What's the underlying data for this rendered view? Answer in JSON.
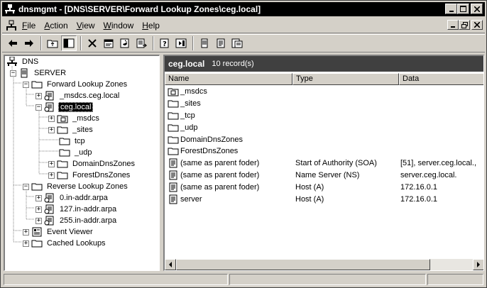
{
  "window": {
    "title": "dnsmgmt - [DNS\\SERVER\\Forward Lookup Zones\\ceg.local]",
    "controls": [
      "minimize",
      "maximize",
      "close"
    ]
  },
  "menu": {
    "items": [
      {
        "label": "File",
        "key": "F",
        "rest": "ile"
      },
      {
        "label": "Action",
        "key": "A",
        "rest": "ction"
      },
      {
        "label": "View",
        "key": "V",
        "rest": "iew"
      },
      {
        "label": "Window",
        "key": "W",
        "rest": "indow"
      },
      {
        "label": "Help",
        "key": "H",
        "rest": "elp"
      }
    ]
  },
  "toolbar": {
    "tools": [
      "back-icon",
      "forward-icon",
      "up-folder-icon",
      "show-hide-tree-icon",
      "delete-icon",
      "properties-icon",
      "refresh-icon",
      "export-list-icon",
      "help-icon",
      "action-pane-icon",
      "server-icon",
      "record-icon",
      "new-zone-icon"
    ]
  },
  "tree": {
    "root": "DNS",
    "server": "SERVER",
    "forward_zones": "Forward Lookup Zones",
    "msdcs_zone": "_msdcs.ceg.local",
    "selected_zone": "ceg.local",
    "children": [
      "_msdcs",
      "_sites",
      "tcp",
      "_udp",
      "DomainDnsZones",
      "ForestDnsZones"
    ],
    "reverse_zones": "Reverse Lookup Zones",
    "reverse_items": [
      "0.in-addr.arpa",
      "127.in-addr.arpa",
      "255.in-addr.arpa"
    ],
    "event_viewer": "Event Viewer",
    "cached_lookups": "Cached Lookups"
  },
  "details": {
    "zone_name": "ceg.local",
    "record_count": "10 record(s)",
    "columns": [
      "Name",
      "Type",
      "Data"
    ],
    "rows": [
      {
        "icon": "delegated-folder-icon",
        "name": "_msdcs",
        "type": "",
        "data": ""
      },
      {
        "icon": "folder-icon",
        "name": "_sites",
        "type": "",
        "data": ""
      },
      {
        "icon": "folder-icon",
        "name": "_tcp",
        "type": "",
        "data": ""
      },
      {
        "icon": "folder-icon",
        "name": "_udp",
        "type": "",
        "data": ""
      },
      {
        "icon": "folder-icon",
        "name": "DomainDnsZones",
        "type": "",
        "data": ""
      },
      {
        "icon": "folder-icon",
        "name": "ForestDnsZones",
        "type": "",
        "data": ""
      },
      {
        "icon": "record-icon",
        "name": "(same as parent foder)",
        "type": "Start of Authority (SOA)",
        "data": "[51], server.ceg.local.,"
      },
      {
        "icon": "record-icon",
        "name": "(same as parent foder)",
        "type": "Name Server (NS)",
        "data": "server.ceg.local."
      },
      {
        "icon": "record-icon",
        "name": "(same as parent foder)",
        "type": "Host (A)",
        "data": "172.16.0.1"
      },
      {
        "icon": "record-icon",
        "name": "server",
        "type": "Host (A)",
        "data": "172.16.0.1"
      }
    ]
  }
}
